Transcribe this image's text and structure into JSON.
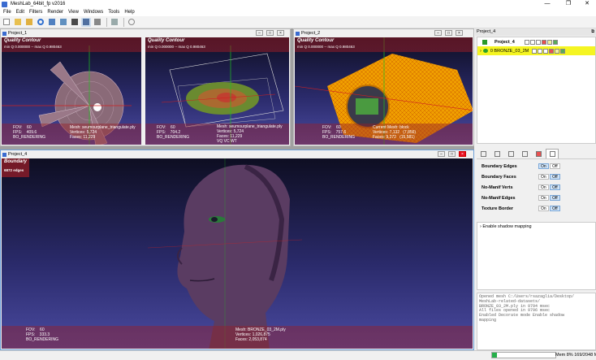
{
  "window": {
    "title": "MeshLab_64bit_fp v2016"
  },
  "menu": [
    "File",
    "Edit",
    "Filters",
    "Render",
    "View",
    "Windows",
    "Tools",
    "Help"
  ],
  "views": {
    "p1": {
      "title": "Project_1",
      "overlay_title": "Quality Contour",
      "overlay_sub": "min Q 0.000000 -- max Q 0.980463",
      "left_info": "FOV:    60\nFPS:    409.6\nBO_RENDERING",
      "right_info": "Mesh: seumourplane_triangulate.ply\nVertices: 5,724\nFaces: 11,229"
    },
    "p1b": {
      "overlay_title": "Quality Contour",
      "overlay_sub": "min Q 0.000000 -- max Q 0.980463",
      "left_info": "FOV:    60\nFPS:    704.2\nBO_RENDERING",
      "right_info": "Mesh: seumourplane_triangulate.ply\nVertices: 5,724\nFaces: 11,229\nVQ VC WT"
    },
    "p2": {
      "title": "Project_2",
      "overlay_title": "Quality Contour",
      "overlay_sub": "min Q 0.000000 -- max Q 0.980463",
      "left_info": "FOV:    60\nFPS:    757.6\nBO_RENDERING",
      "right_info": "Current Mesh: block\nVertices: 7,132   (7,856)\nFaces: 9,272   (15,581)"
    },
    "p4": {
      "title": "Project_4",
      "overlay_title": "Boundary",
      "overlay_sub": "6872 edges",
      "left_info": "FOV:    60\nFPS:    333.3\nBO_RENDERING",
      "right_info": "Mesh: BRONZE_03_2M.ply\nVertices: 1,026,875\nFaces: 2,053,874"
    }
  },
  "right_panel": {
    "title": "Project_4",
    "project_label": "Project_4",
    "layer_label": "0  BRONZE_03_2M",
    "decorations": [
      {
        "label": "Boundary Edges",
        "on": "On",
        "off": "Off",
        "active": "on"
      },
      {
        "label": "Boundary Faces",
        "on": "On",
        "off": "Off",
        "active": "off"
      },
      {
        "label": "No-Manif Verts",
        "on": "On",
        "off": "Off",
        "active": "off"
      },
      {
        "label": "No-Manif Edges",
        "on": "On",
        "off": "Off",
        "active": "off"
      },
      {
        "label": "Texture Border",
        "on": "On",
        "off": "Off",
        "active": "off"
      }
    ],
    "shadow_label": "Enable shadow mapping",
    "log": "Opened mesh C:/Users/rsazaglia/Desktop/\nMeshLab-related-datasets/\nBRONZE_03_2M.ply in 9794 msec\nAll files opened in 9796 msec\nEnabled Decorate mode Enable shadow\nmapping"
  },
  "status": {
    "mem_text": "Mem 8% 169/2048 M",
    "mem_fraction": 0.08
  },
  "colors": {
    "overlay": "#962228",
    "selected_layer": "#f5f522",
    "mem_bar": "#26b04a"
  }
}
